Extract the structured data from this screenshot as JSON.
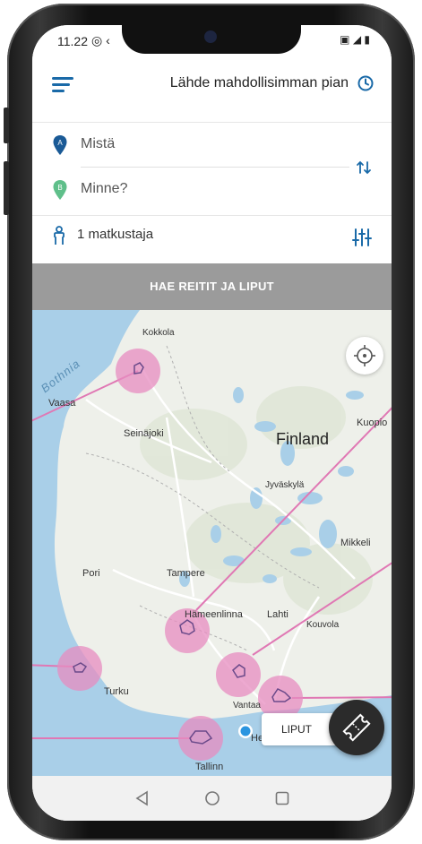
{
  "status_bar": {
    "time": "11.22",
    "left_icons": "◎ ‹",
    "right_icons": "▣ ◢ ▮"
  },
  "header": {
    "departure_label": "Lähde mahdollisimman pian"
  },
  "route_form": {
    "origin_placeholder": "Mistä",
    "destination_placeholder": "Minne?",
    "origin_pin_letter": "A",
    "destination_pin_letter": "B",
    "travellers": "1 matkustaja"
  },
  "search_button": "HAE REITIT JA LIPUT",
  "map": {
    "labels": {
      "kokkola": "Kokkola",
      "bothnia": "Bothnia",
      "vaasa": "Vaasa",
      "seinajoki": "Seinäjoki",
      "finland": "Finland",
      "kuopio": "Kuopio",
      "jyvaskyla": "Jyväskylä",
      "mikkeli": "Mikkeli",
      "pori": "Pori",
      "tampere": "Tampere",
      "hameenlinna": "Hämeenlinna",
      "lahti": "Lahti",
      "kouvola": "Kouvola",
      "turku": "Turku",
      "vantaa": "Vantaa",
      "helsinki": "He",
      "tallinn": "Tallinn"
    }
  },
  "liput_button": "LIPUT",
  "colors": {
    "brand_blue": "#1a6aa8",
    "pin_a": "#1a5a96",
    "pin_b": "#5fbf8a",
    "search_bg": "#9b9b9b",
    "highlight_pink": "#e78cc0"
  },
  "icons": [
    "hamburger-icon",
    "clock-icon",
    "pin-a-icon",
    "pin-b-icon",
    "swap-icon",
    "person-icon",
    "filter-icon",
    "locate-icon",
    "ticket-icon",
    "back-nav-icon",
    "home-nav-icon",
    "recents-nav-icon"
  ]
}
